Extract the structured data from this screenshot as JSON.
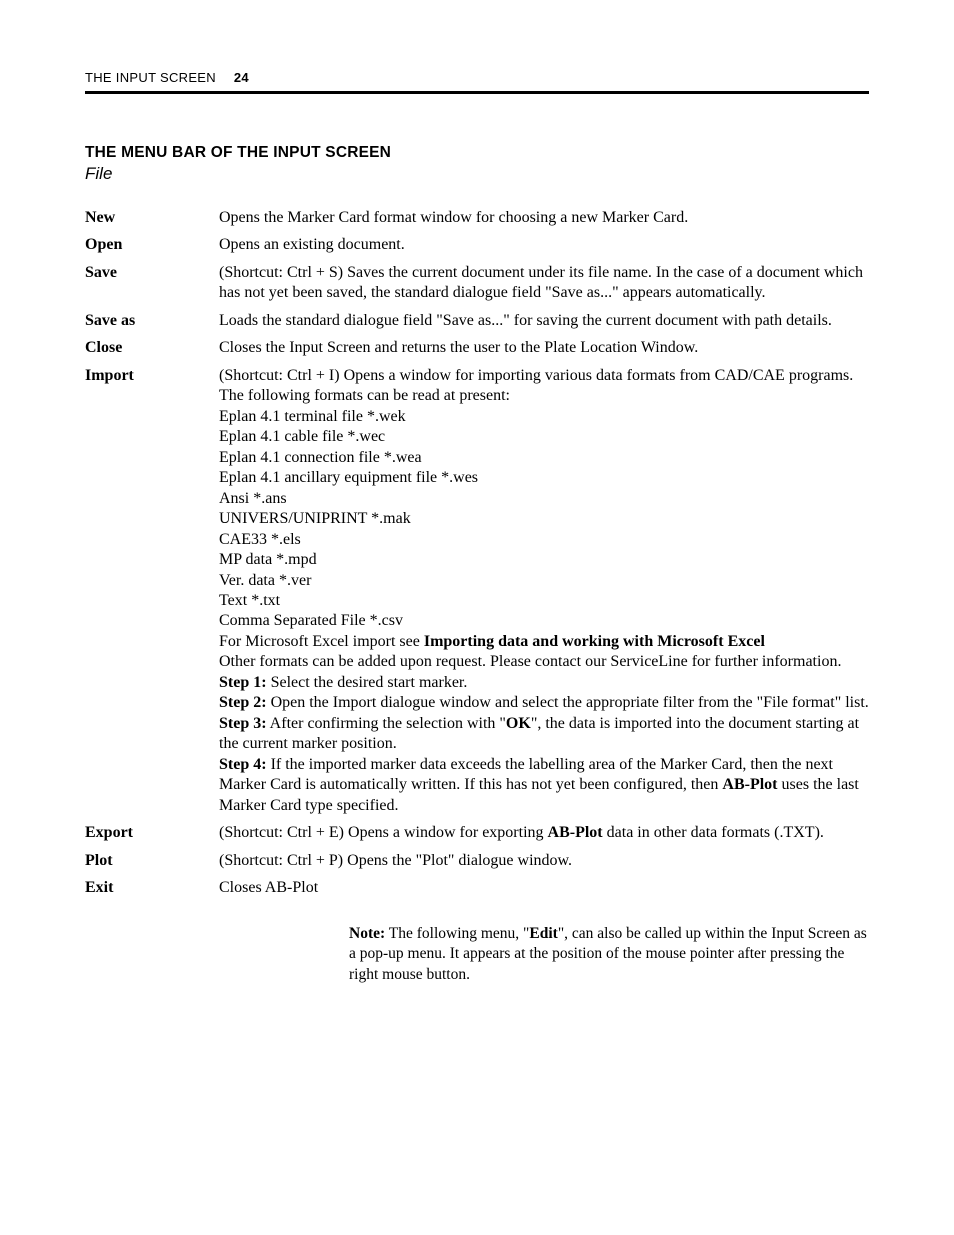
{
  "header": {
    "running_title": "THE INPUT SCREEN",
    "page_number": "24"
  },
  "section": {
    "heading": "THE MENU BAR OF THE INPUT SCREEN",
    "subheading": "File"
  },
  "menu": {
    "new": {
      "label": "New",
      "desc": "Opens the Marker Card format window for choosing a new Marker Card."
    },
    "open": {
      "label": "Open",
      "desc": "Opens an existing document."
    },
    "save": {
      "label": "Save",
      "desc": "(Shortcut: Ctrl + S) Saves the current document under its file name. In the case of a document which has not yet been saved, the standard dialogue field \"Save as...\" appears automatically."
    },
    "saveas": {
      "label": "Save as",
      "desc": "Loads the standard dialogue field \"Save as...\" for saving the current document with path details."
    },
    "close": {
      "label": "Close",
      "desc": "Closes the Input Screen and returns the user to the Plate Location Window."
    },
    "import": {
      "label": "Import",
      "intro": "(Shortcut: Ctrl + I) Opens a window for importing various data formats from CAD/CAE programs. The following formats can be read at present:",
      "fmt1": "Eplan 4.1 terminal file *.wek",
      "fmt2": "Eplan 4.1 cable file *.wec",
      "fmt3": "Eplan 4.1 connection file *.wea",
      "fmt4": "Eplan 4.1 ancillary equipment file *.wes",
      "fmt5": "Ansi *.ans",
      "fmt6": "UNIVERS/UNIPRINT *.mak",
      "fmt7": "CAE33 *.els",
      "fmt8": "MP data *.mpd",
      "fmt9": "Ver. data *.ver",
      "fmt10": "Text *.txt",
      "fmt11": "Comma Separated File *.csv",
      "excel_pre": "For Microsoft Excel import see ",
      "excel_link": "Importing data and working with Microsoft Excel",
      "other": "Other formats can be added upon request. Please contact our ServiceLine for further information.",
      "step1_label": "Step 1:",
      "step1_text": " Select the desired start marker.",
      "step2_label": "Step 2:",
      "step2_text": " Open the Import dialogue window and select the appropriate filter from the \"File format\" list.",
      "step3_label": "Step 3:",
      "step3_text_a": " After confirming the selection with \"",
      "step3_ok": "OK",
      "step3_text_b": "\", the data is imported into the document starting at the current marker position.",
      "step4_label": "Step 4:",
      "step4_text_a": " If the imported marker data exceeds the labelling area of the Marker Card, then the next Marker Card is automatically written. If this has not yet been configured, then ",
      "step4_abplot": "AB-Plot",
      "step4_text_b": " uses the last Marker Card type specified."
    },
    "export": {
      "label": "Export",
      "desc_a": "(Shortcut: Ctrl + E) Opens a window for exporting ",
      "desc_b": "AB-Plot",
      "desc_c": " data in other data formats (.TXT)."
    },
    "plot": {
      "label": "Plot",
      "desc": "(Shortcut: Ctrl + P) Opens the \"Plot\" dialogue window."
    },
    "exit": {
      "label": "Exit",
      "desc": "Closes AB-Plot"
    }
  },
  "note": {
    "label": "Note:",
    "text_a": " The following menu, \"",
    "edit": "Edit",
    "text_b": "\", can also be called up within the Input Screen as a pop-up menu. It appears at the position of the mouse pointer after pressing the right mouse button."
  }
}
